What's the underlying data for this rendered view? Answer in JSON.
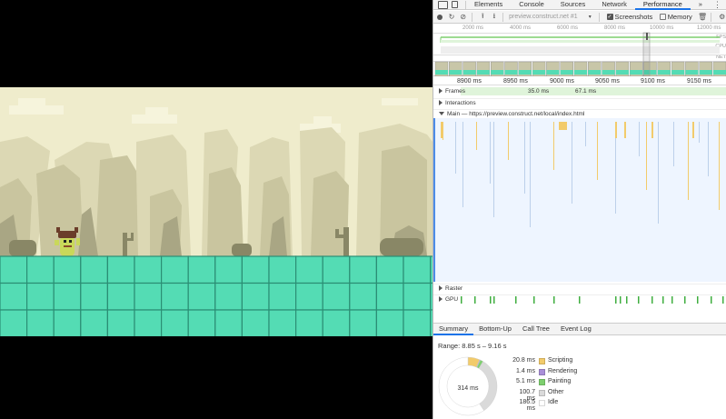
{
  "devtools": {
    "tabs": [
      "Elements",
      "Console",
      "Sources",
      "Network",
      "Performance"
    ],
    "active_tab": "Performance",
    "more_tabs": "»",
    "kebab": "⋮",
    "toolbar": {
      "profile_placeholder": "preview.construct.net #1",
      "screenshots_label": "Screenshots",
      "screenshots_checked": true,
      "memory_label": "Memory",
      "memory_checked": false
    },
    "overview": {
      "ticks": [
        "2000 ms",
        "4000 ms",
        "6000 ms",
        "8000 ms",
        "10000 ms",
        "12000 ms"
      ],
      "labels": [
        "FPS",
        "CPU",
        "NET"
      ]
    },
    "ruler": [
      "8900 ms",
      "8950 ms",
      "9000 ms",
      "9050 ms",
      "9100 ms",
      "9150 ms"
    ],
    "tracks": {
      "frames": {
        "label": "Frames",
        "values": [
          "35.0 ms",
          "67.1 ms"
        ]
      },
      "interactions": "Interactions",
      "main": "Main — https://preview.construct.net/local/index.html",
      "raster": "Raster",
      "gpu": "GPU"
    },
    "bottom_tabs": [
      "Summary",
      "Bottom-Up",
      "Call Tree",
      "Event Log"
    ],
    "summary": {
      "range": "Range: 8.85 s – 9.16 s",
      "total": "314 ms",
      "items": [
        {
          "value": "20.8 ms",
          "name": "Scripting",
          "color": "#f2cb6b"
        },
        {
          "value": "1.4 ms",
          "name": "Rendering",
          "color": "#a98fd8"
        },
        {
          "value": "5.1 ms",
          "name": "Painting",
          "color": "#7ecf6f"
        },
        {
          "value": "100.7 ms",
          "name": "Other",
          "color": "#dadada"
        },
        {
          "value": "186.5 ms",
          "name": "Idle",
          "color": "#ffffff"
        }
      ]
    }
  },
  "game": {
    "sky_color": "#efeccc",
    "ground_color": "#54dcb4",
    "ground_line_color": "#2b8e74"
  }
}
